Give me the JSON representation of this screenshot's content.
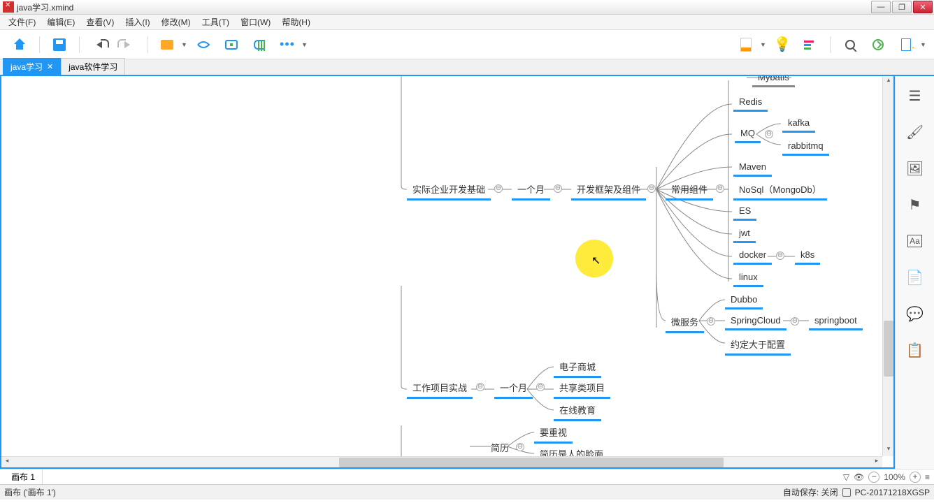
{
  "window": {
    "title": "java学习.xmind"
  },
  "menu": {
    "file": "文件(F)",
    "edit": "编辑(E)",
    "view": "查看(V)",
    "insert": "插入(I)",
    "modify": "修改(M)",
    "tools": "工具(T)",
    "window": "窗口(W)",
    "help": "帮助(H)"
  },
  "tabs": {
    "active": "java学习",
    "inactive": "java软件学习"
  },
  "sheet": {
    "name": "画布 1"
  },
  "zoom": {
    "value": "100%"
  },
  "status": {
    "selection": "画布 ('画布 1')",
    "autosave": "自动保存: 关闭",
    "computer": "PC-20171218XGSP"
  },
  "nodes": {
    "enterprise_basics": "实际企业开发基础",
    "one_month_a": "一个月",
    "dev_framework": "开发框架及组件",
    "common_components": "常用组件",
    "mybatis": "Mybatis",
    "redis": "Redis",
    "mq": "MQ",
    "kafka": "kafka",
    "rabbitmq": "rabbitmq",
    "maven": "Maven",
    "nosql": "NoSql（MongoDb）",
    "es": "ES",
    "jwt": "jwt",
    "docker": "docker",
    "k8s": "k8s",
    "linux": "linux",
    "microservice": "微服务",
    "dubbo": "Dubbo",
    "springcloud": "SpringCloud",
    "springboot": "springboot",
    "config_over": "约定大于配置",
    "project_practice": "工作项目实战",
    "one_month_b": "一个月",
    "ecommerce": "电子商城",
    "sharing": "共享类项目",
    "online_edu": "在线教育",
    "resume": "简历",
    "important": "要重视",
    "resume_face": "简历是人的脸面"
  },
  "collapse_marker": "⊖"
}
